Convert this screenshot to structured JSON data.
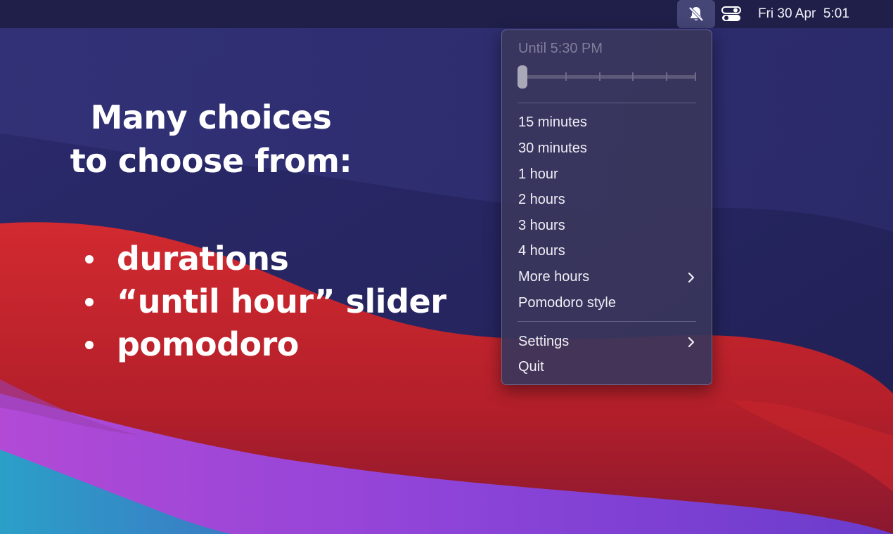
{
  "menubar": {
    "clock": "Fri 30 Apr  5:01",
    "icons": [
      "bell-slash-icon",
      "control-center-icon"
    ]
  },
  "headline": {
    "line1": "Many choices",
    "line2": "to choose from:"
  },
  "features": [
    "durations",
    "“until hour” slider",
    "pomodoro"
  ],
  "menu": {
    "until_label": "Until 5:30 PM",
    "slider": {
      "ticks": 6,
      "value_fraction": 0
    },
    "durations": [
      "15 minutes",
      "30 minutes",
      "1 hour",
      "2 hours",
      "3 hours",
      "4 hours"
    ],
    "more_hours": "More hours",
    "pomodoro": "Pomodoro style",
    "settings": "Settings",
    "quit": "Quit"
  },
  "colors": {
    "wallpaper_blue": "#262663",
    "wallpaper_red": "#c4242c",
    "wallpaper_purple": "#9a48d8",
    "wallpaper_teal": "#2a8ec0"
  }
}
